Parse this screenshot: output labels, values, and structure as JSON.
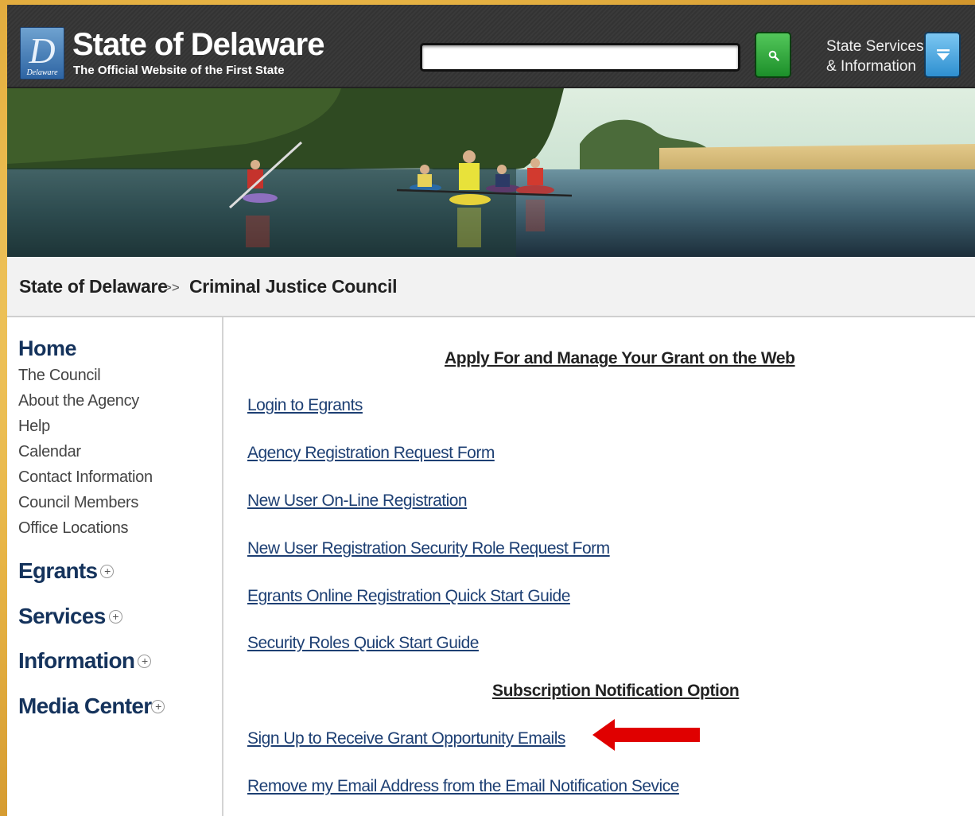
{
  "header": {
    "logo_letter": "D",
    "logo_caption": "Delaware",
    "site_title": "State of Delaware",
    "site_subtitle": "The Official Website of the First State",
    "search": {
      "value": "",
      "placeholder": ""
    },
    "services_label_line1": "State Services",
    "services_label_line2": "& Information"
  },
  "breadcrumb": {
    "items": [
      "State of Delaware",
      "Criminal Justice Council"
    ],
    "separator": ">>"
  },
  "sidebar": {
    "home": "Home",
    "links": [
      "The Council",
      "About the Agency",
      "Help",
      "Calendar",
      "Contact Information",
      "Council Members",
      "Office Locations"
    ],
    "sections": [
      {
        "label": "Egrants",
        "expander": "+"
      },
      {
        "label": "Services",
        "expander": "+"
      },
      {
        "label": "Information",
        "expander": "+"
      },
      {
        "label": "Media Center",
        "expander": "+"
      }
    ]
  },
  "main": {
    "heading1": "Apply For and Manage Your Grant on the Web",
    "links1": [
      "Login to Egrants",
      "Agency Registration Request Form",
      "New User On-Line Registration",
      "New User Registration Security Role Request Form",
      "Egrants Online Registration Quick Start Guide",
      "Security Roles Quick Start Guide"
    ],
    "heading2": "Subscription Notification Option",
    "links2": [
      "Sign Up to Receive Grant Opportunity Emails",
      "Remove my Email Address from the Email Notification Sevice"
    ]
  },
  "colors": {
    "header_bg": "#333333",
    "search_button": "#2ea83a",
    "services_button": "#4aa8e2",
    "nav_heading": "#15335c",
    "link": "#1d3f73",
    "annotation_arrow": "#e00000",
    "frame_border": "#e7b445"
  },
  "icons": {
    "search_button": "search-icon",
    "services_button": "chevron-down-icon",
    "expanders": "plus-icon",
    "annotation": "left-arrow-icon"
  }
}
